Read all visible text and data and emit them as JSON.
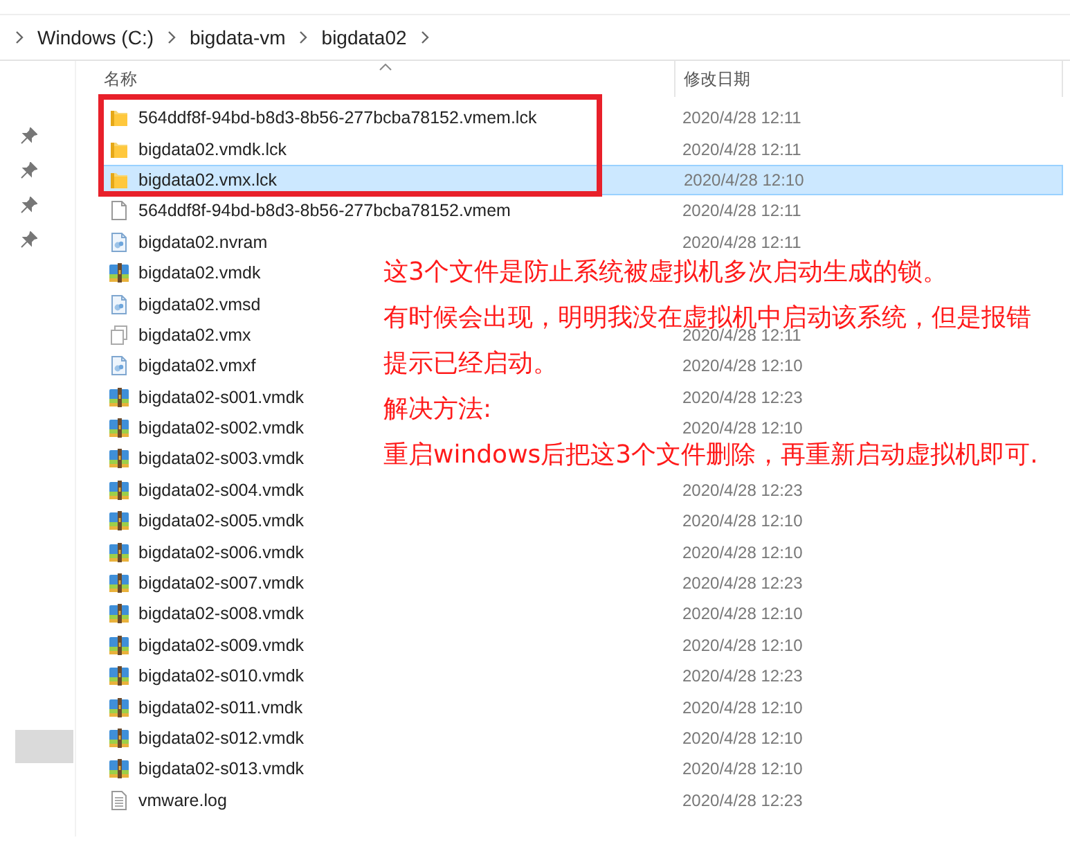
{
  "breadcrumb": [
    "Windows (C:)",
    "bigdata-vm",
    "bigdata02"
  ],
  "columns": [
    "名称",
    "修改日期"
  ],
  "files": [
    {
      "name": "564ddf8f-94bd-b8d3-8b56-277bcba78152.vmem.lck",
      "date": "2020/4/28 12:11",
      "kind": "folder",
      "selected": false,
      "boxed": true
    },
    {
      "name": "bigdata02.vmdk.lck",
      "date": "2020/4/28 12:11",
      "kind": "folder",
      "selected": false,
      "boxed": true
    },
    {
      "name": "bigdata02.vmx.lck",
      "date": "2020/4/28 12:10",
      "kind": "folder",
      "selected": true,
      "boxed": true
    },
    {
      "name": "564ddf8f-94bd-b8d3-8b56-277bcba78152.vmem",
      "date": "2020/4/28 12:11",
      "kind": "file",
      "selected": false,
      "boxed": false
    },
    {
      "name": "bigdata02.nvram",
      "date": "2020/4/28 12:11",
      "kind": "config",
      "selected": false,
      "boxed": false
    },
    {
      "name": "bigdata02.vmdk",
      "kind": "disk",
      "selected": false,
      "boxed": false
    },
    {
      "name": "bigdata02.vmsd",
      "kind": "config",
      "selected": false,
      "boxed": false
    },
    {
      "name": "bigdata02.vmx",
      "date": "2020/4/28 12:11",
      "kind": "vmx",
      "selected": false,
      "boxed": false
    },
    {
      "name": "bigdata02.vmxf",
      "date": "2020/4/28 12:10",
      "kind": "config",
      "selected": false,
      "boxed": false
    },
    {
      "name": "bigdata02-s001.vmdk",
      "date": "2020/4/28 12:23",
      "kind": "disk",
      "selected": false,
      "boxed": false
    },
    {
      "name": "bigdata02-s002.vmdk",
      "date": "2020/4/28 12:10",
      "kind": "disk",
      "selected": false,
      "boxed": false
    },
    {
      "name": "bigdata02-s003.vmdk",
      "kind": "disk",
      "selected": false,
      "boxed": false
    },
    {
      "name": "bigdata02-s004.vmdk",
      "date": "2020/4/28 12:23",
      "kind": "disk",
      "selected": false,
      "boxed": false
    },
    {
      "name": "bigdata02-s005.vmdk",
      "date": "2020/4/28 12:10",
      "kind": "disk",
      "selected": false,
      "boxed": false
    },
    {
      "name": "bigdata02-s006.vmdk",
      "date": "2020/4/28 12:10",
      "kind": "disk",
      "selected": false,
      "boxed": false
    },
    {
      "name": "bigdata02-s007.vmdk",
      "date": "2020/4/28 12:23",
      "kind": "disk",
      "selected": false,
      "boxed": false
    },
    {
      "name": "bigdata02-s008.vmdk",
      "date": "2020/4/28 12:10",
      "kind": "disk",
      "selected": false,
      "boxed": false
    },
    {
      "name": "bigdata02-s009.vmdk",
      "date": "2020/4/28 12:10",
      "kind": "disk",
      "selected": false,
      "boxed": false
    },
    {
      "name": "bigdata02-s010.vmdk",
      "date": "2020/4/28 12:23",
      "kind": "disk",
      "selected": false,
      "boxed": false
    },
    {
      "name": "bigdata02-s011.vmdk",
      "date": "2020/4/28 12:10",
      "kind": "disk",
      "selected": false,
      "boxed": false
    },
    {
      "name": "bigdata02-s012.vmdk",
      "date": "2020/4/28 12:10",
      "kind": "disk",
      "selected": false,
      "boxed": false
    },
    {
      "name": "bigdata02-s013.vmdk",
      "date": "2020/4/28 12:10",
      "kind": "disk",
      "selected": false,
      "boxed": false
    },
    {
      "name": "vmware.log",
      "date": "2020/4/28 12:23",
      "kind": "log",
      "selected": false,
      "boxed": false
    }
  ],
  "annotation": [
    "这3个文件是防止系统被虚拟机多次启动生成的锁。",
    "有时候会出现，明明我没在虚拟机中启动该系统，但是报错",
    "提示已经启动。",
    "解决方法:",
    "重启windows后把这3个文件删除，再重新启动虚拟机即可."
  ]
}
